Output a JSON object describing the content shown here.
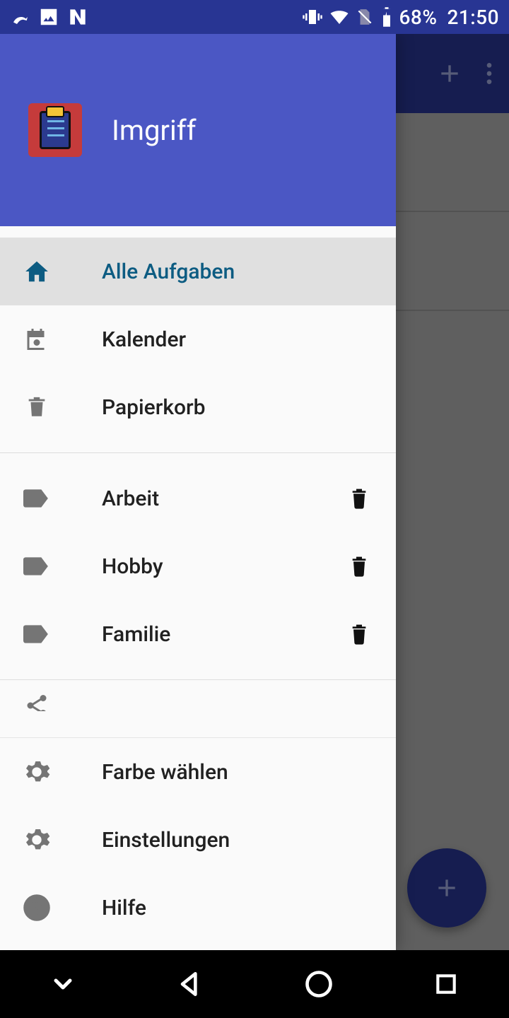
{
  "status": {
    "battery": "68%",
    "time": "21:50"
  },
  "app": {
    "title": "Imgriff"
  },
  "drawer": {
    "main": [
      {
        "label": "Alle Aufgaben",
        "icon": "home",
        "selected": true
      },
      {
        "label": "Kalender",
        "icon": "calendar",
        "selected": false
      },
      {
        "label": "Papierkorb",
        "icon": "trash",
        "selected": false
      }
    ],
    "tags": [
      {
        "label": "Arbeit"
      },
      {
        "label": "Hobby"
      },
      {
        "label": "Familie"
      }
    ],
    "bottom": [
      {
        "label": "Farbe wählen",
        "icon": "gear"
      },
      {
        "label": "Einstellungen",
        "icon": "gear"
      },
      {
        "label": "Hilfe",
        "icon": "help"
      }
    ]
  }
}
